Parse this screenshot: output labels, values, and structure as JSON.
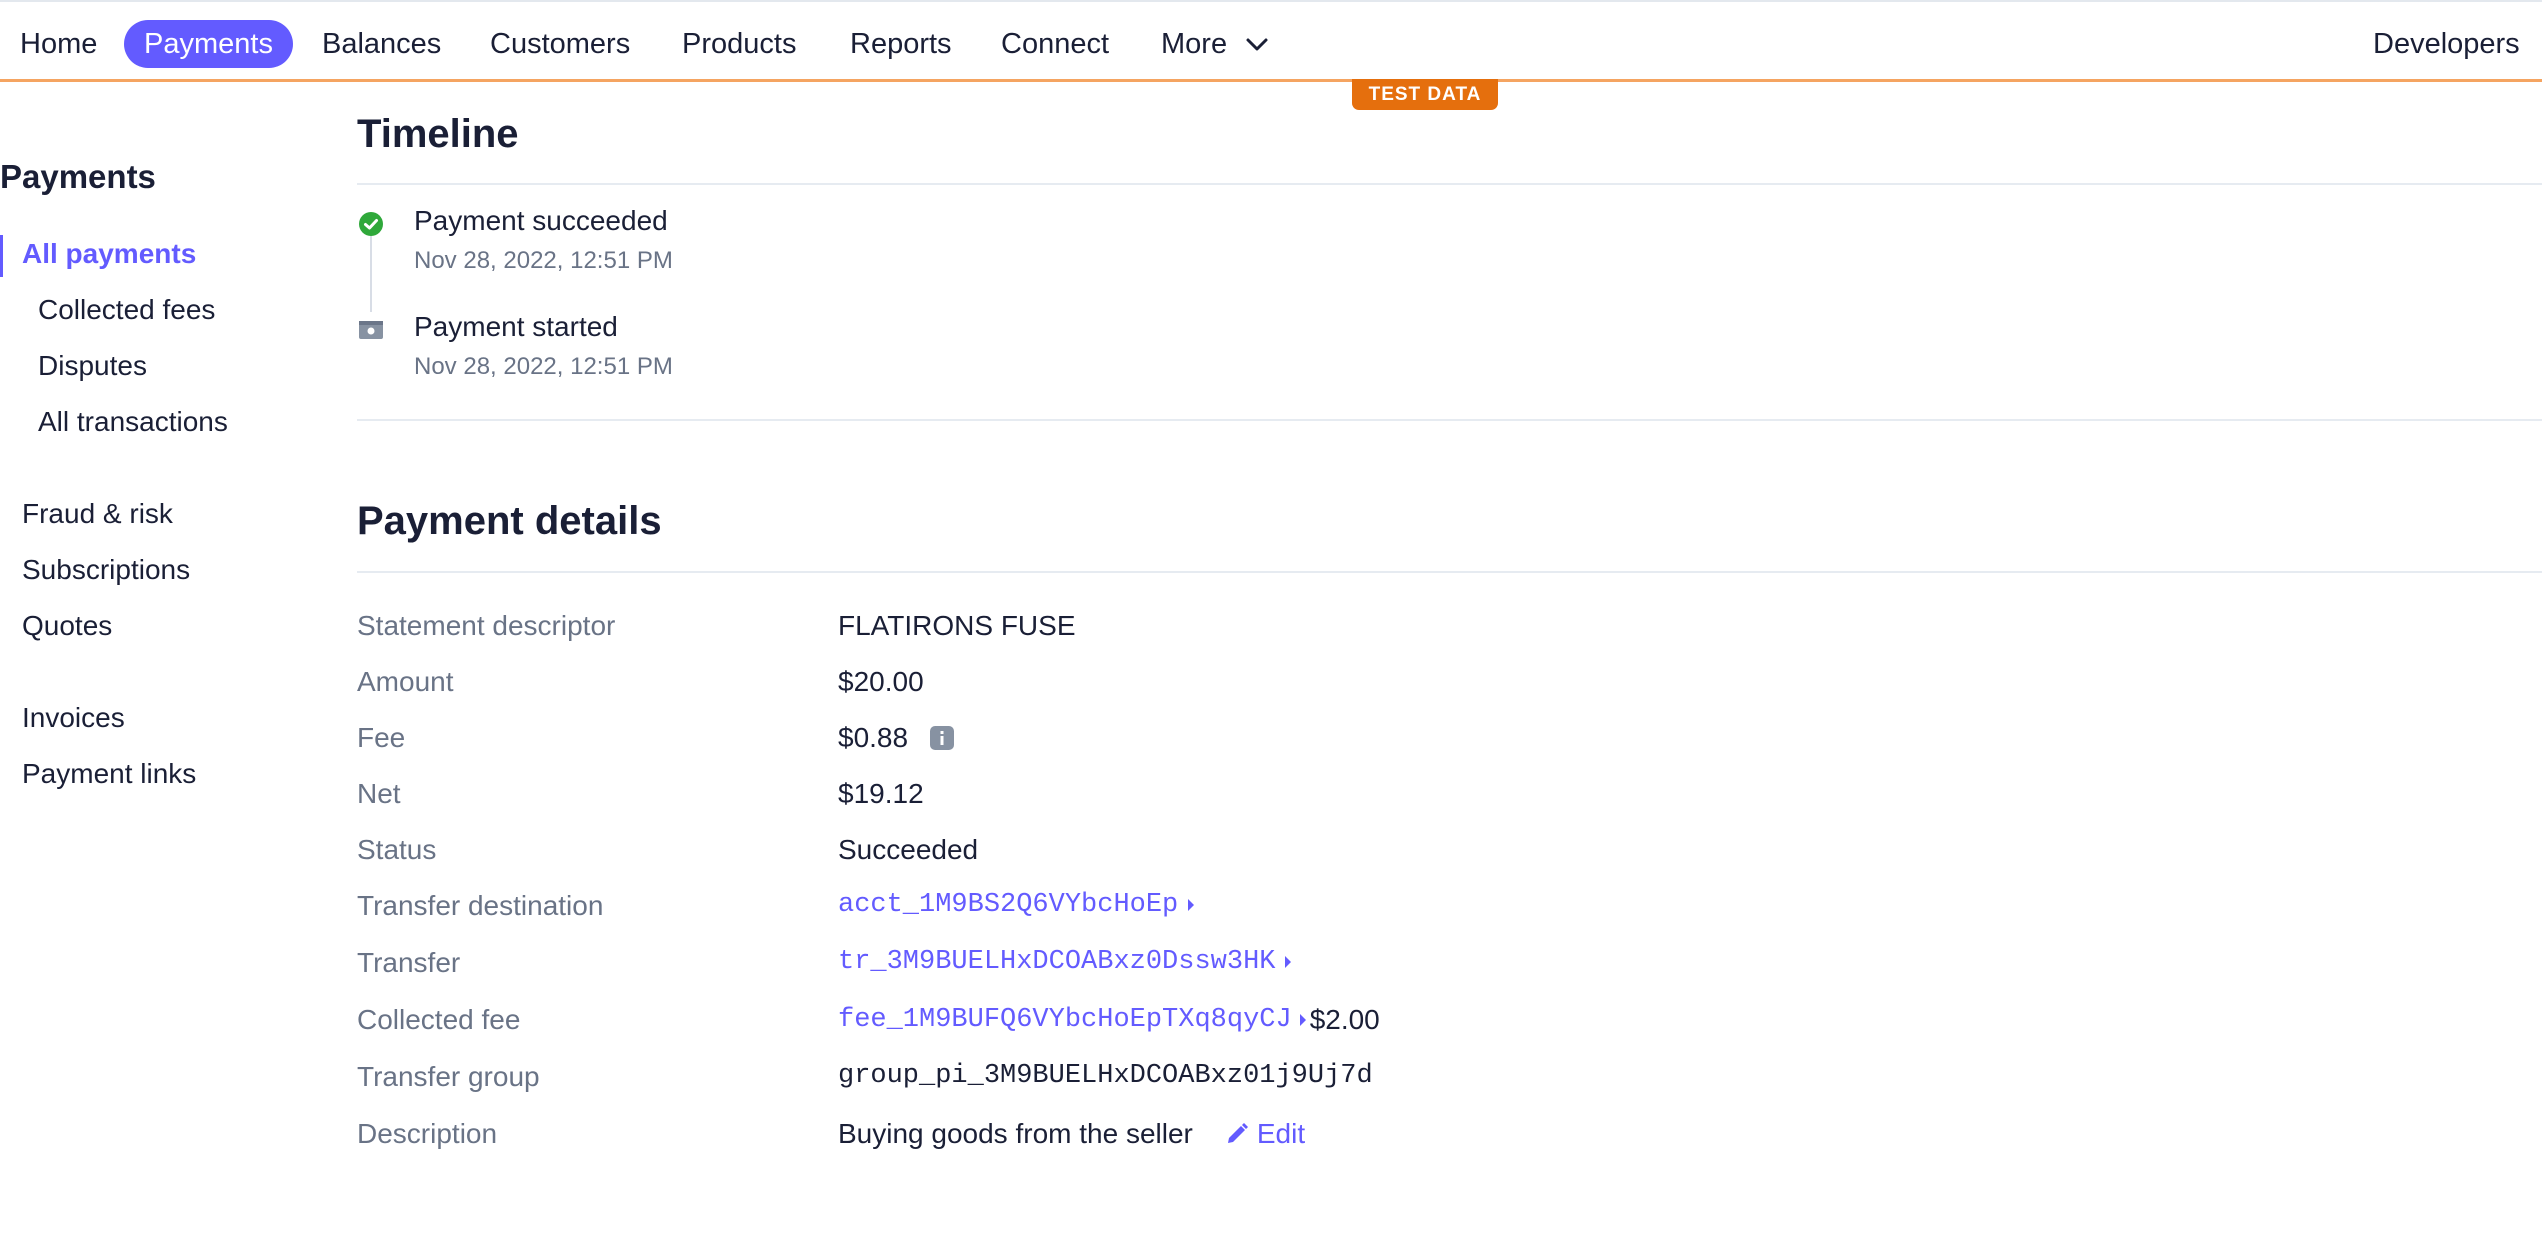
{
  "nav": {
    "items": [
      "Home",
      "Payments",
      "Balances",
      "Customers",
      "Products",
      "Reports",
      "Connect",
      "More"
    ],
    "active": "Payments",
    "developers": "Developers"
  },
  "badge": "TEST DATA",
  "sidebar": {
    "title": "Payments",
    "items": [
      "All payments",
      "Collected fees",
      "Disputes",
      "All transactions",
      "Fraud & risk",
      "Subscriptions",
      "Quotes",
      "Invoices",
      "Payment links"
    ]
  },
  "timeline": {
    "title": "Timeline",
    "events": [
      {
        "title": "Payment succeeded",
        "date": "Nov 28, 2022, 12:51 PM"
      },
      {
        "title": "Payment started",
        "date": "Nov 28, 2022, 12:51 PM"
      }
    ]
  },
  "details": {
    "title": "Payment details",
    "labels": [
      "Statement descriptor",
      "Amount",
      "Fee",
      "Net",
      "Status",
      "Transfer destination",
      "Transfer",
      "Collected fee",
      "Transfer group",
      "Description"
    ],
    "statement_descriptor": "FLATIRONS FUSE",
    "amount": "$20.00",
    "fee": "$0.88",
    "net": "$19.12",
    "status": "Succeeded",
    "transfer_destination": "acct_1M9BS2Q6VYbcHoEp",
    "transfer": "tr_3M9BUELHxDCOABxz0Dssw3HK",
    "collected_fee_id": "fee_1M9BUFQ6VYbcHoEpTXq8qyCJ",
    "collected_fee_amount": "$2.00",
    "transfer_group": "group_pi_3M9BUELHxDCOABxz01j9Uj7d",
    "description": "Buying goods from the seller",
    "edit_label": "Edit"
  },
  "colors": {
    "accent": "#635bff",
    "test_badge": "#e56f0d",
    "success": "#2fa83a"
  }
}
